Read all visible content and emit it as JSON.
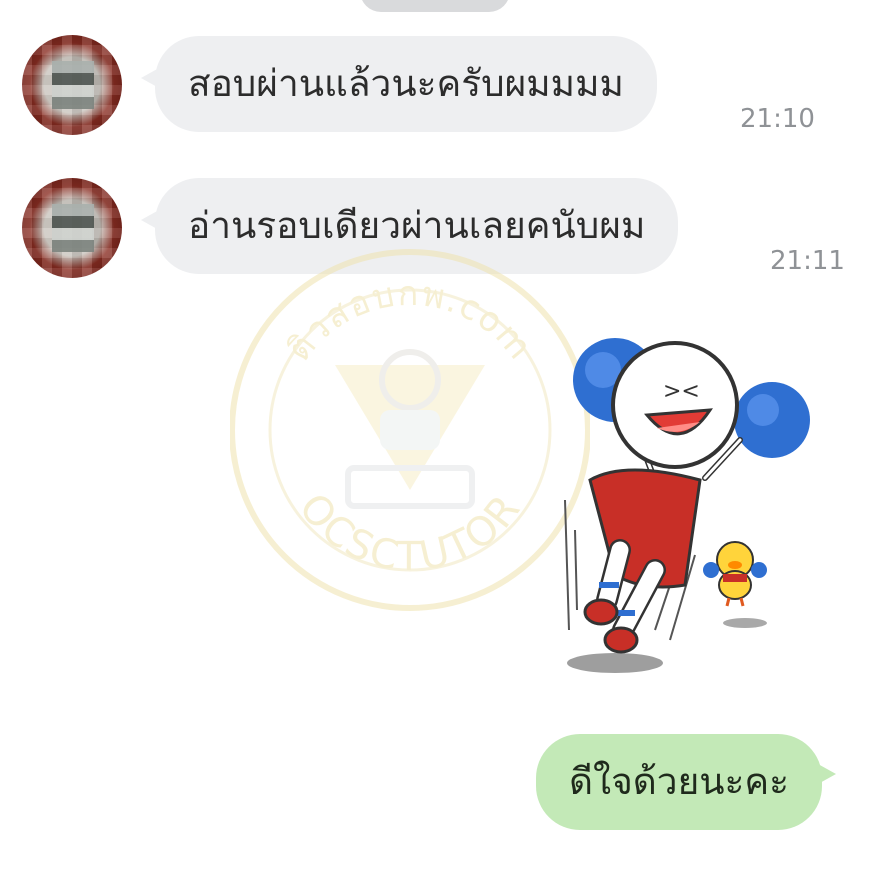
{
  "messages": [
    {
      "text": "สอบผ่านแล้วนะครับผมมมม",
      "time": "21:10"
    },
    {
      "text": "อ่านรอบเดียวผ่านเลยคนับผม",
      "time": "21:11"
    }
  ],
  "reply": {
    "text": "ดีใจด้วยนะคะ"
  },
  "watermark": {
    "top_text": "ติวสอบกพ.com",
    "bottom_text": "OCSCTUTOR"
  },
  "sticker": {
    "name": "cheerleader-character-sticker"
  },
  "colors": {
    "incoming_bubble": "#eeeff1",
    "outgoing_bubble": "#c3e9b7",
    "time_text": "#8f9296"
  }
}
